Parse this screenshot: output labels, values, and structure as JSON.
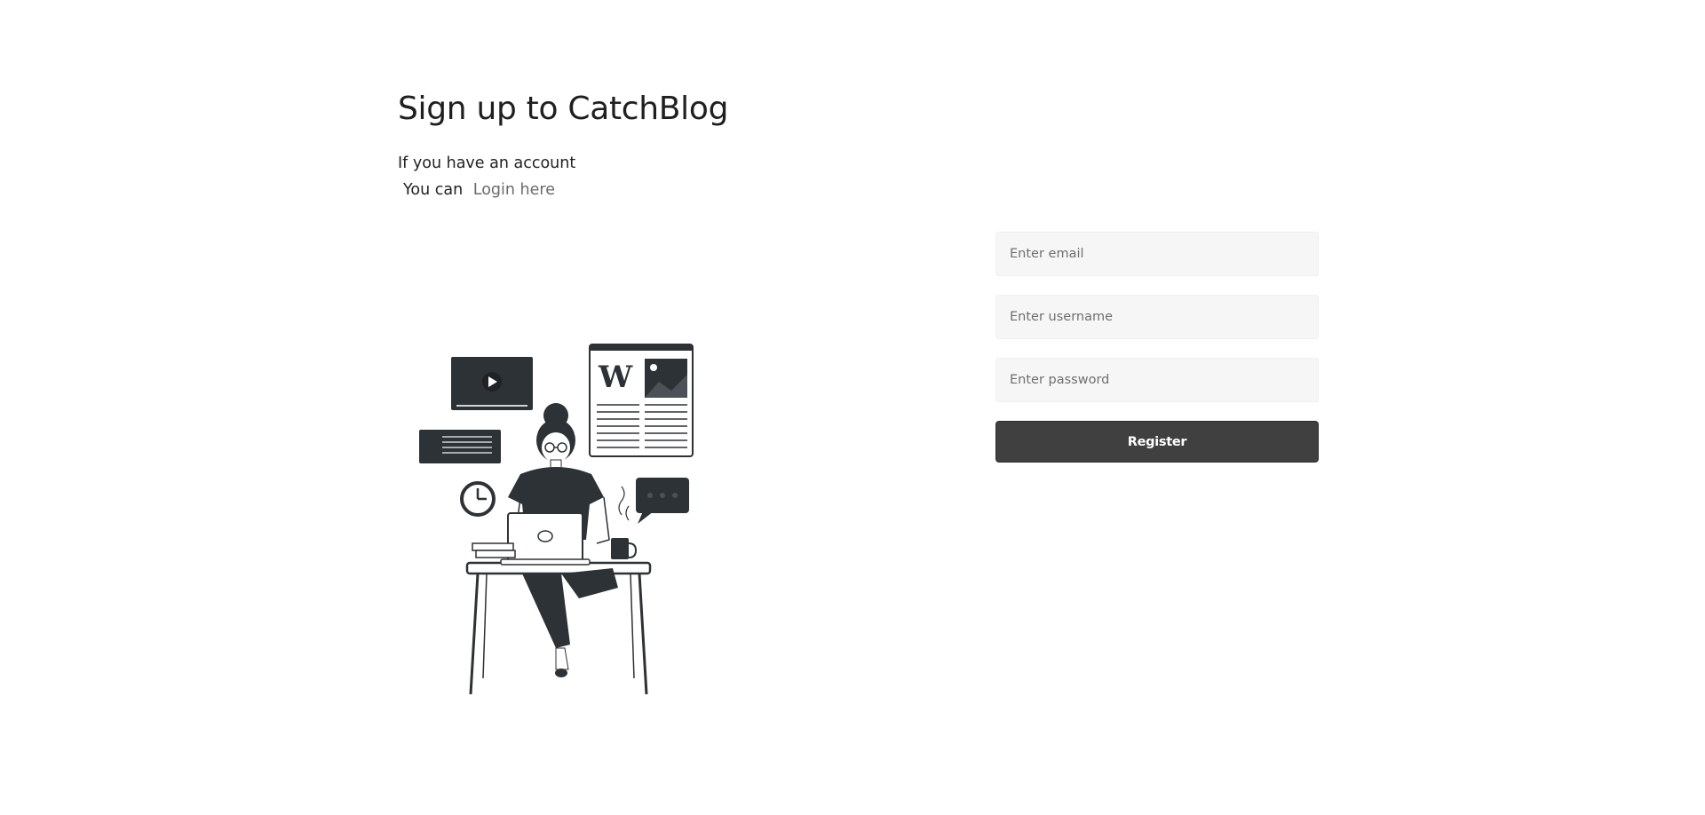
{
  "header": {
    "title": "Sign up to CatchBlog",
    "subtitle": "If you have an account",
    "login_prefix": "You can",
    "login_link": "Login here"
  },
  "form": {
    "email_placeholder": "Enter email",
    "username_placeholder": "Enter username",
    "password_placeholder": "Enter password",
    "submit_label": "Register"
  },
  "illustration": {
    "newspaper_letter": "W"
  },
  "colors": {
    "button_bg": "#404040",
    "input_bg": "#f6f6f6",
    "illustration_dark": "#2d3236"
  }
}
